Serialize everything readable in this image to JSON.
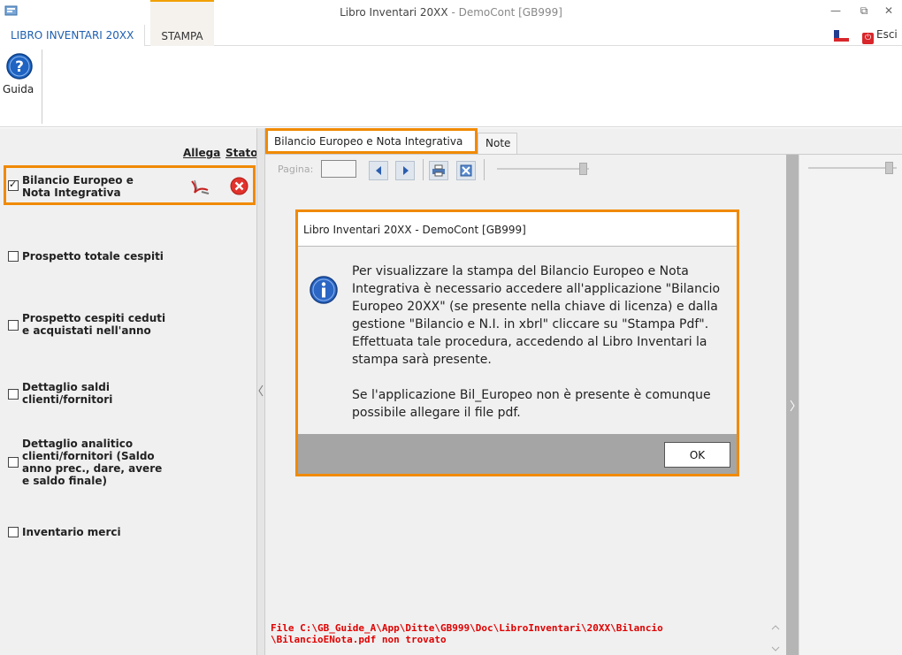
{
  "window": {
    "title_main": "Libro Inventari 20XX",
    "title_suffix": " - DemoCont [GB999]",
    "controls": [
      "—",
      "⧉",
      "✕"
    ]
  },
  "ribbon": {
    "tabs": [
      {
        "label": "LIBRO INVENTARI 20XX"
      },
      {
        "label": "STAMPA"
      }
    ],
    "exit_label": "Esci",
    "help_label": "Guida"
  },
  "left_panel": {
    "col_attach": "Allega",
    "col_status": "Stato",
    "items": [
      {
        "label_1": "Bilancio Europeo e",
        "label_2": "Nota Integrativa",
        "checked": true
      },
      {
        "label_1": "Prospetto totale cespiti",
        "checked": false
      },
      {
        "label_1": "Prospetto cespiti ceduti",
        "label_2": "e acquistati nell'anno",
        "checked": false
      },
      {
        "label_1": "Dettaglio saldi",
        "label_2": "clienti/fornitori",
        "checked": false
      },
      {
        "label_1": "Dettaglio analitico",
        "label_2": "clienti/fornitori (Saldo",
        "label_3": "anno prec., dare, avere",
        "label_4": "e saldo finale)",
        "checked": false
      },
      {
        "label_1": "Inventario merci",
        "checked": false
      }
    ]
  },
  "doc_tabs": [
    {
      "label": "Bilancio Europeo e Nota Integrativa"
    },
    {
      "label": "Note"
    }
  ],
  "viewer": {
    "page_label": "Pagina:",
    "error_line_1": "File C:\\GB_Guide_A\\App\\Ditte\\GB999\\Doc\\LibroInventari\\20XX\\Bilancio",
    "error_line_2": "\\BilancioENota.pdf non trovato"
  },
  "dialog": {
    "title": "Libro Inventari 20XX - DemoCont [GB999]",
    "message_1": "Per visualizzare la stampa del Bilancio Europeo e Nota Integrativa è necessario accedere all'applicazione \"Bilancio Europeo 20XX\" (se presente nella chiave di licenza) e dalla gestione \"Bilancio e N.I. in xbrl\" cliccare su \"Stampa Pdf\". Effettuata tale procedura, accedendo al Libro Inventari la stampa sarà presente.",
    "message_2": "Se l'applicazione Bil_Europeo non è presente è comunque possibile allegare il file pdf.",
    "ok_label": "OK"
  },
  "colors": {
    "highlight": "#f08a00",
    "accent_blue": "#1e5fb0",
    "error_red": "#e00000"
  },
  "icons": [
    "app-icon",
    "minimize-icon",
    "restore-icon",
    "close-icon",
    "flag-icon",
    "power-icon",
    "help-icon",
    "pdf-attach-icon",
    "error-status-icon",
    "prev-page-icon",
    "next-page-icon",
    "print-icon",
    "export-icon",
    "info-icon"
  ]
}
